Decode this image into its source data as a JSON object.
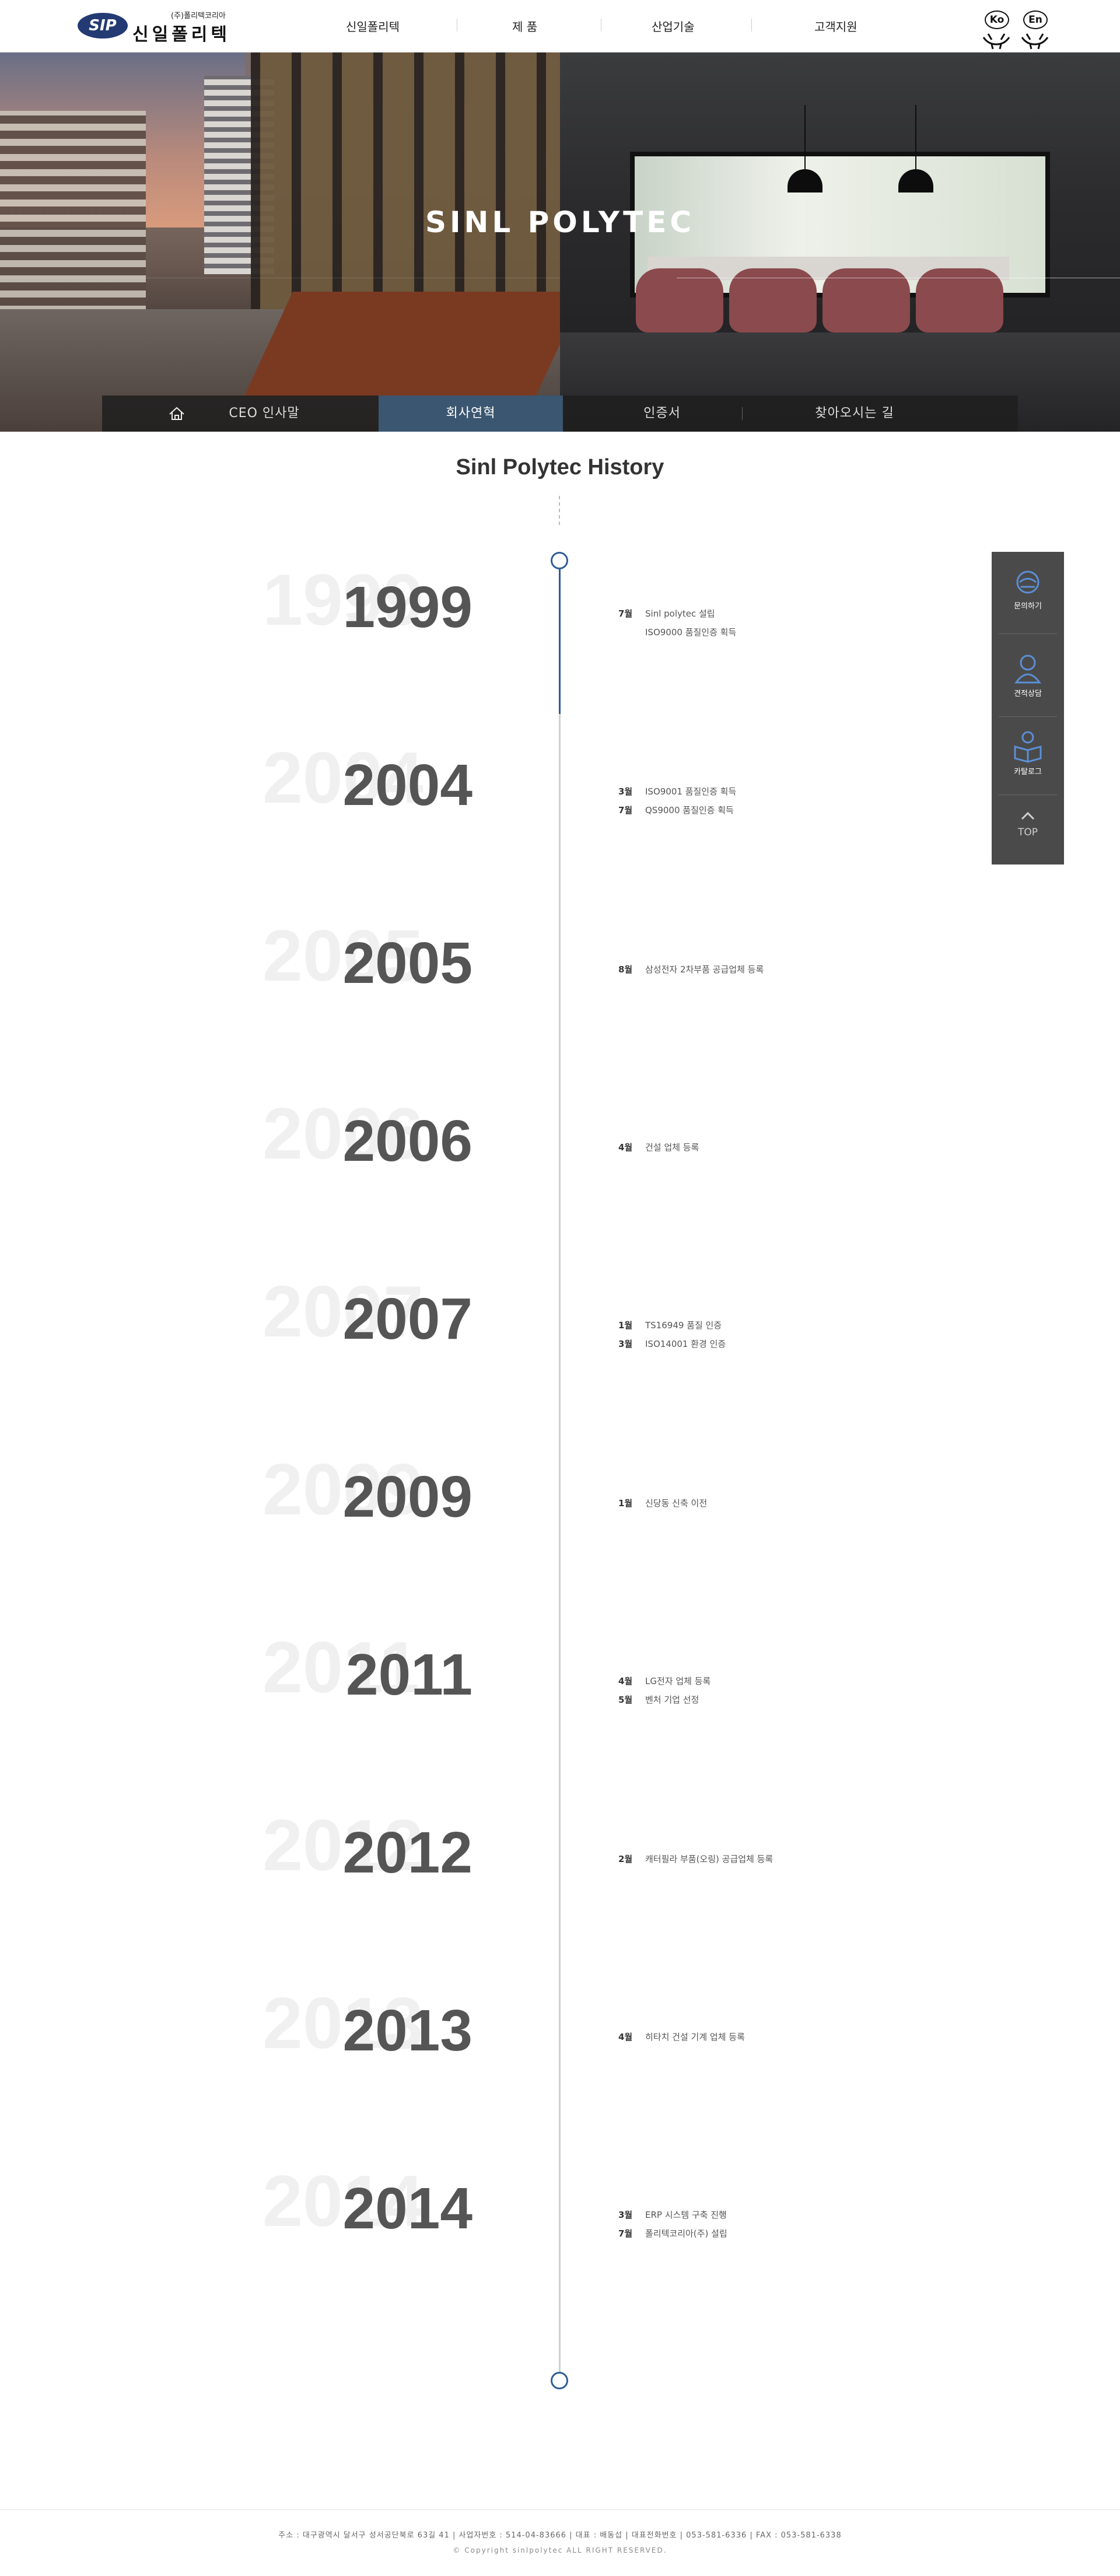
{
  "header": {
    "logo_mark": "SIP",
    "logo_sub": "(주)폴리텍코리아",
    "logo_main": "신일폴리텍",
    "nav": [
      "신일폴리텍",
      "제 품",
      "산업기술",
      "고객지원"
    ],
    "lang": [
      "Ko",
      "En"
    ]
  },
  "hero": {
    "title": "SINL POLYTEC"
  },
  "subnav": {
    "home_icon": "home-icon",
    "items": [
      "CEO 인사말",
      "회사연혁",
      "인증서",
      "찾아오시는 길"
    ],
    "active_index": 1
  },
  "history": {
    "title": "Sinl Polytec History",
    "entries": [
      {
        "year": "1999",
        "events": [
          {
            "month": "7월",
            "text": "Sinl polytec 설립"
          },
          {
            "month": "",
            "text": "ISO9000 품질인증 획득"
          }
        ]
      },
      {
        "year": "2004",
        "events": [
          {
            "month": "3월",
            "text": "ISO9001 품질인증 획득"
          },
          {
            "month": "7월",
            "text": "QS9000 품질인증 획득"
          }
        ]
      },
      {
        "year": "2005",
        "events": [
          {
            "month": "8월",
            "text": "삼성전자 2차부품 공급업체 등록"
          }
        ]
      },
      {
        "year": "2006",
        "events": [
          {
            "month": "4월",
            "text": "건설 업체 등록"
          }
        ]
      },
      {
        "year": "2007",
        "events": [
          {
            "month": "1월",
            "text": "TS16949 품질 인증"
          },
          {
            "month": "3월",
            "text": "ISO14001 환경 인증"
          }
        ]
      },
      {
        "year": "2009",
        "events": [
          {
            "month": "1월",
            "text": "신당동 신축 이전"
          }
        ]
      },
      {
        "year": "2011",
        "events": [
          {
            "month": "4월",
            "text": "LG전자 업체 등록"
          },
          {
            "month": "5월",
            "text": "벤처 기업 선정"
          }
        ]
      },
      {
        "year": "2012",
        "events": [
          {
            "month": "2월",
            "text": "캐터필라 부품(오링) 공급업체 등록"
          }
        ]
      },
      {
        "year": "2013",
        "events": [
          {
            "month": "4월",
            "text": "히타치 건설 기계 업체 등록"
          }
        ]
      },
      {
        "year": "2014",
        "events": [
          {
            "month": "3월",
            "text": "ERP 시스템 구축 진행"
          },
          {
            "month": "7월",
            "text": "폴리텍코리아(주) 설립"
          }
        ]
      }
    ]
  },
  "quick_menu": {
    "items": [
      {
        "label": "문의하기",
        "icon": "inquiry-icon"
      },
      {
        "label": "견적상담",
        "icon": "consult-icon"
      },
      {
        "label": "카탈로그",
        "icon": "catalog-icon"
      }
    ],
    "top_label": "TOP"
  },
  "footer": {
    "address": "주소 : 대구광역시 달서구 성서공단북로 63길 41  |  사업자번호 : 514-04-83666  |  대표 : 배동섭  |  대표전화번호  |  053-581-6336  |  FAX : 053-581-6338",
    "copyright": "© Copyright sinlpolytec ALL RIGHT RESERVED."
  },
  "colors": {
    "accent": "#2f5d97",
    "subnav_active": "#3b5670",
    "quick_bg": "#4a4a4a"
  }
}
